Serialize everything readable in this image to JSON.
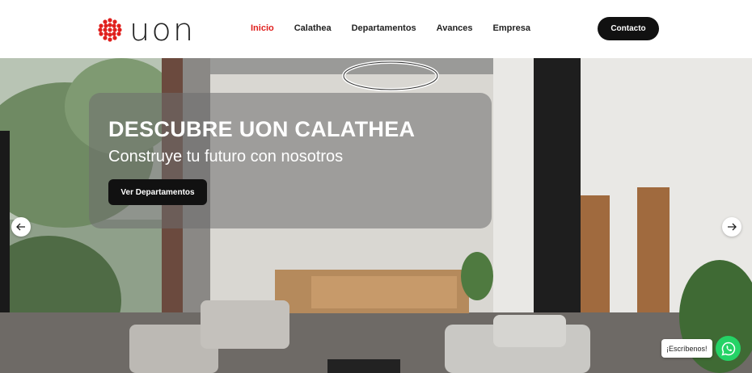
{
  "header": {
    "brand": "uon",
    "nav": [
      {
        "label": "Inicio",
        "active": true
      },
      {
        "label": "Calathea",
        "active": false
      },
      {
        "label": "Departamentos",
        "active": false
      },
      {
        "label": "Avances",
        "active": false
      },
      {
        "label": "Empresa",
        "active": false
      }
    ],
    "contact_label": "Contacto"
  },
  "hero": {
    "title": "DESCUBRE UON CALATHEA",
    "subtitle": "Construye tu futuro con nosotros",
    "cta_label": "Ver Departamentos",
    "prev_icon": "arrow-left-icon",
    "next_icon": "arrow-right-icon"
  },
  "chat": {
    "label": "¡Escríbenos!",
    "icon": "whatsapp-icon"
  },
  "colors": {
    "accent": "#e0201e",
    "dark": "#111111",
    "whatsapp": "#25d366"
  }
}
